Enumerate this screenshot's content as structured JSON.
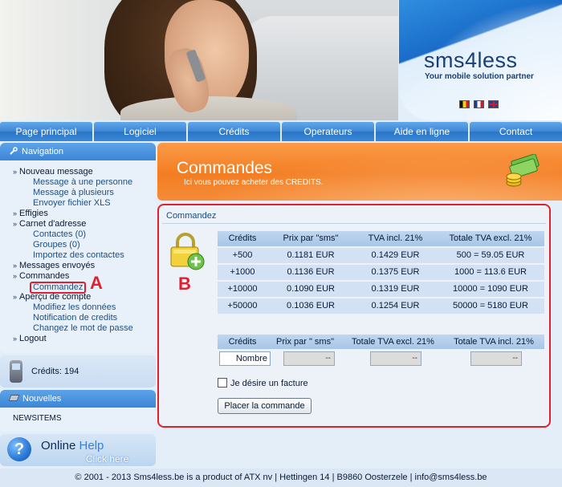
{
  "header": {
    "logo": "sms4less",
    "tagline": "Your mobile solution partner",
    "languages": [
      "nl",
      "fr",
      "en"
    ]
  },
  "nav": {
    "items": [
      "Page principal",
      "Logiciel",
      "Crédits",
      "Operateurs",
      "Aide en ligne",
      "Contact"
    ]
  },
  "sidebar": {
    "title": "Navigation",
    "menu": [
      {
        "label": "Nouveau message",
        "sub": [
          "Message à une personne",
          "Message à plusieurs",
          "Envoyer fichier XLS"
        ]
      },
      {
        "label": "Effigies",
        "sub": []
      },
      {
        "label": "Carnet d'adresse",
        "sub": [
          "Contactes (0)",
          "Groupes (0)",
          "Importez des contactes"
        ]
      },
      {
        "label": "Messages envoyés",
        "sub": []
      },
      {
        "label": "Commandes",
        "sub": [
          "Commandez"
        ]
      },
      {
        "label": "Aperçu de compte",
        "sub": [
          "Modifiez les données",
          "Notification de credits",
          "Changez le mot de passe"
        ]
      },
      {
        "label": "Logout",
        "sub": []
      }
    ],
    "credits": "Crédits: 194",
    "news_title": "Nouvelles",
    "news_items": "NEWSITEMS",
    "help_title_a": "Online ",
    "help_title_b": "Help",
    "help_sub": "Click here",
    "annotation": "A"
  },
  "banner": {
    "title": "Commandes",
    "subtitle": "Ici vous pouvez acheter des CREDITS."
  },
  "panel": {
    "title": "Commandez",
    "annotation": "B",
    "price_table": {
      "headers": [
        "Crédits",
        "Prix par \"sms\"",
        "TVA incl. 21%",
        "Totale TVA excl. 21%"
      ],
      "rows": [
        [
          "+500",
          "0.1181 EUR",
          "0.1429 EUR",
          "500 = 59.05 EUR"
        ],
        [
          "+1000",
          "0.1136 EUR",
          "0.1375 EUR",
          "1000 = 113.6 EUR"
        ],
        [
          "+10000",
          "0.1090 EUR",
          "0.1319 EUR",
          "10000 = 1090 EUR"
        ],
        [
          "+50000",
          "0.1036 EUR",
          "0.1254 EUR",
          "50000 = 5180 EUR"
        ]
      ]
    },
    "order_table": {
      "headers": [
        "Crédits",
        "Prix par \" sms\"",
        "Totale TVA excl. 21%",
        "Totale TVA incl. 21%"
      ],
      "nombre_placeholder": "Nombre",
      "price_value": "--",
      "total_excl_value": "--",
      "total_incl_value": "--"
    },
    "invoice_label": "Je désire un facture",
    "order_button": "Placer la commande"
  },
  "footer": {
    "text": "© 2001 - 2013 Sms4less.be is a product of ATX nv | Hettingen 14 | B9860 Oosterzele | info@sms4less.be"
  },
  "colors": {
    "nav_blue": "#3b86d6",
    "banner_orange": "#f37d22",
    "annotation_red": "#e02030"
  }
}
